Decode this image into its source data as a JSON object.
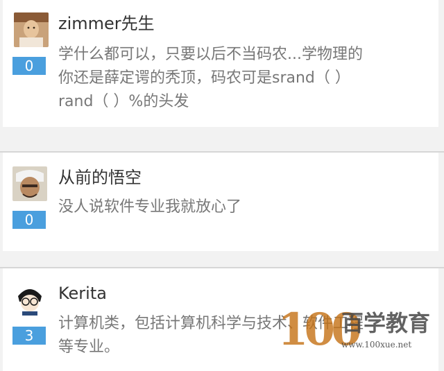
{
  "comments": [
    {
      "username": "zimmer先生",
      "likes": "0",
      "text_lines": [
        "学什么都可以，只要以后不当码农...学物理的",
        "你还是薛定谔的秃顶，码农可是srand（ ）",
        "rand（ ）%的头发"
      ]
    },
    {
      "username": "从前的悟空",
      "likes": "0",
      "text_lines": [
        "没人说软件专业我就放心了"
      ]
    },
    {
      "username": "Kerita",
      "likes": "3",
      "text_lines": [
        "计算机类，包括计算机科学与技术、软件工程",
        "等专业。"
      ]
    }
  ],
  "watermark": {
    "digits": "100",
    "text": "百学教育",
    "url": "www.100xue.net"
  },
  "colors": {
    "badge": "#4a9fde",
    "background": "#f2f2f2",
    "card": "#ffffff"
  }
}
